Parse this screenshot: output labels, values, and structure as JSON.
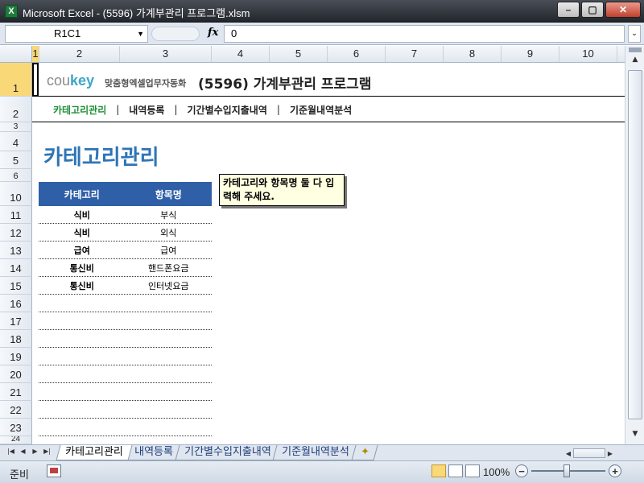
{
  "window": {
    "app_icon": "X",
    "title": "Microsoft Excel - (5596) 가계부관리 프로그램.xlsm",
    "minimize": "–",
    "restore": "▢",
    "close": "✕"
  },
  "formula_bar": {
    "name_box": "R1C1",
    "fx": "fx",
    "value": "0"
  },
  "columns": [
    "1",
    "2",
    "3",
    "4",
    "5",
    "6",
    "7",
    "8",
    "9",
    "10"
  ],
  "rows": [
    "1",
    "2",
    "3",
    "4",
    "5",
    "6",
    "10",
    "11",
    "12",
    "13",
    "14",
    "15",
    "16",
    "17",
    "18",
    "19",
    "20",
    "21",
    "22",
    "23",
    "24"
  ],
  "sheet": {
    "logo_cou": "cou",
    "logo_key": "key",
    "tagline": "맞춤형엑셀업무자동화",
    "app_title": "(5596) 가계부관리 프로그램",
    "nav": [
      "카테고리관리",
      "내역등록",
      "기간별수입지출내역",
      "기준월내역분석"
    ],
    "nav_sep": "|",
    "page_title": "카테고리관리",
    "table": {
      "headers": [
        "카테고리",
        "항목명"
      ],
      "rows": [
        [
          "식비",
          "부식"
        ],
        [
          "식비",
          "외식"
        ],
        [
          "급여",
          "급여"
        ],
        [
          "통신비",
          "핸드폰요금"
        ],
        [
          "통신비",
          "인터넷요금"
        ],
        [
          "",
          ""
        ],
        [
          "",
          ""
        ],
        [
          "",
          ""
        ],
        [
          "",
          ""
        ],
        [
          "",
          ""
        ],
        [
          "",
          ""
        ],
        [
          "",
          ""
        ],
        [
          "",
          ""
        ],
        [
          "",
          ""
        ]
      ]
    },
    "note": "카테고리와 항목명 둘 다 입력해 주세요."
  },
  "tabs": [
    "카테고리관리",
    "내역등록",
    "기간별수입지출내역",
    "기준월내역분석"
  ],
  "status": {
    "ready": "준비",
    "zoom": "100%",
    "zoom_minus": "−",
    "zoom_plus": "+"
  },
  "colors": {
    "title_blue": "#2e75b6",
    "header_blue": "#2f5fa7",
    "nav_active_green": "#1d8f37",
    "logo_key": "#3ba5c9",
    "note_bg": "#ffffe1",
    "selection": "#f9d877"
  }
}
